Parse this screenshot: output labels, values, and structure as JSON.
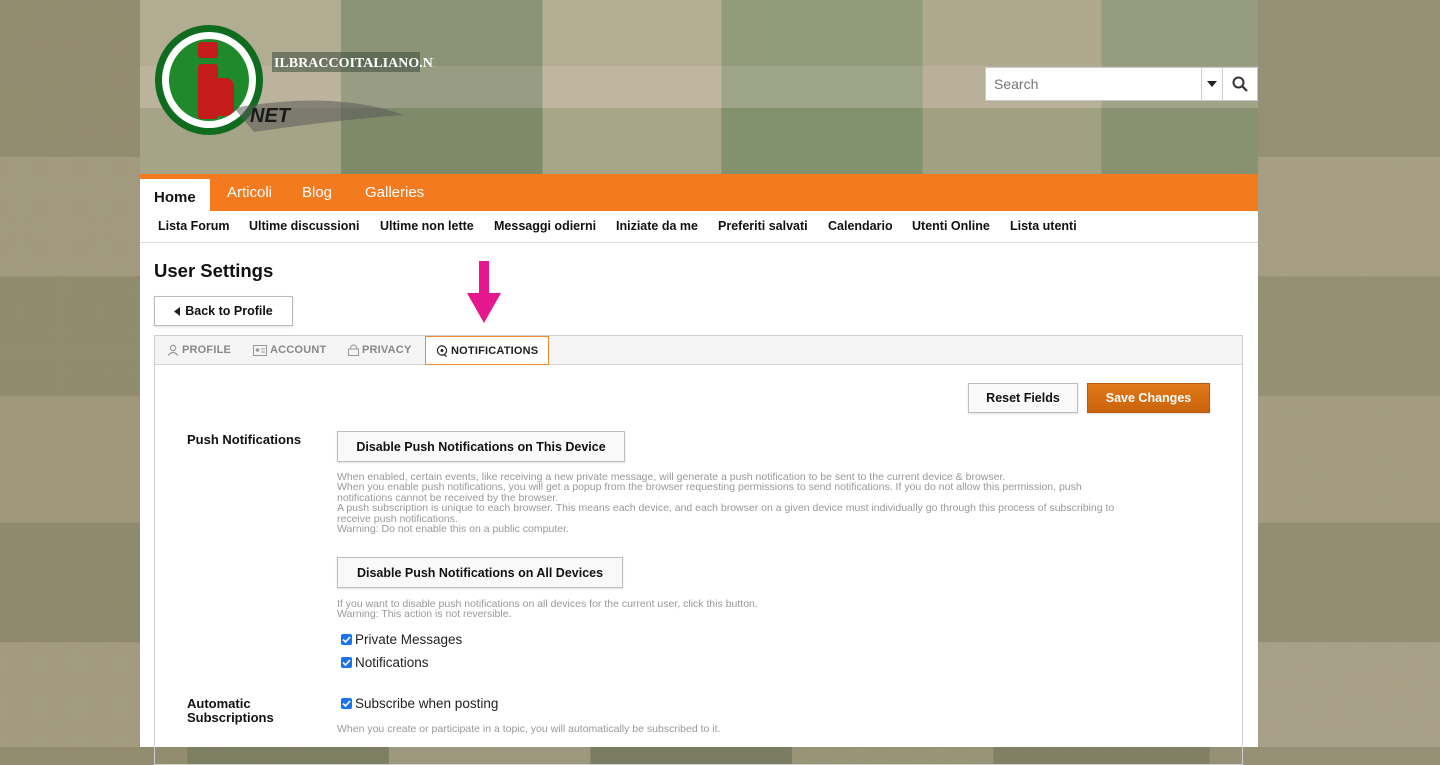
{
  "site": {
    "logo_text": "ILBRACCOITALIANO.NET",
    "logo_letter": "i",
    "logo_suffix": "NET"
  },
  "search": {
    "placeholder": "Search",
    "dropdown_icon": "caret-down-icon",
    "submit_icon": "magnifier-icon"
  },
  "nav": {
    "tabs": [
      "Home",
      "Articoli",
      "Blog",
      "Galleries"
    ],
    "active": "Home"
  },
  "subnav": {
    "items": [
      "Lista Forum",
      "Ultime discussioni",
      "Ultime non lette",
      "Messaggi odierni",
      "Iniziate da me",
      "Preferiti salvati",
      "Calendario",
      "Utenti Online",
      "Lista utenti"
    ]
  },
  "page": {
    "title": "User Settings",
    "back_button": "Back to Profile"
  },
  "settings_tabs": [
    "PROFILE",
    "ACCOUNT",
    "PRIVACY",
    "NOTIFICATIONS"
  ],
  "actions": {
    "reset": "Reset Fields",
    "save": "Save Changes"
  },
  "push": {
    "label": "Push Notifications",
    "button_device": "Disable Push Notifications on This Device",
    "desc_device": [
      "When enabled, certain events, like receiving a new private message, will generate a push notification to be sent to the current device & browser.",
      "When you enable push notifications, you will get a popup from the browser requesting permissions to send notifications. If you do not allow this permission, push",
      "notifications cannot be received by the browser.",
      "A push subscription is unique to each browser. This means each device, and each browser on a given device must individually go through this process of subscribing to",
      "receive push notifications.",
      "Warning: Do not enable this on a public computer."
    ],
    "button_all": "Disable Push Notifications on All Devices",
    "desc_all": [
      "If you want to disable push notifications on all devices for the current user, click this button.",
      "Warning: This action is not reversible."
    ],
    "options": [
      {
        "label": "Private Messages",
        "checked": true
      },
      {
        "label": "Notifications",
        "checked": true
      }
    ]
  },
  "auto": {
    "label_line1": "Automatic",
    "label_line2": "Subscriptions",
    "option": "Subscribe when posting",
    "checked": true,
    "desc": "When you create or participate in a topic, you will automatically be subscribed to it."
  },
  "colors": {
    "nav_orange": "#f47a1f",
    "save_orange": "#d26e12",
    "annotation_arrow": "#e5168e",
    "checkbox_blue": "#1a73e8"
  }
}
